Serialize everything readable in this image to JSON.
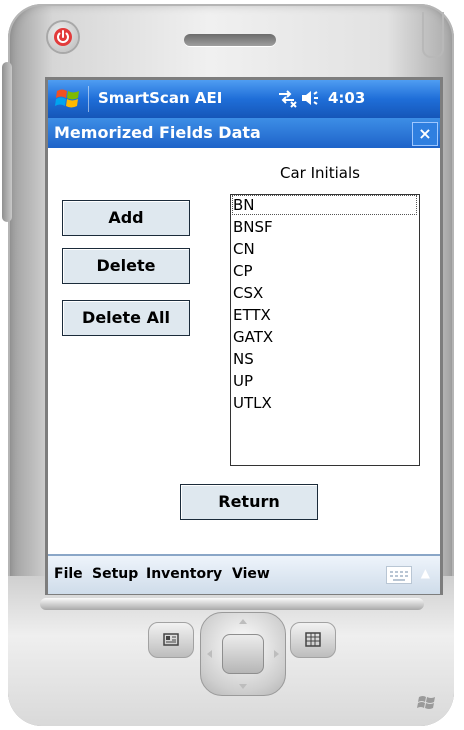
{
  "status_bar": {
    "app_title": "SmartScan AEI",
    "time": "4:03"
  },
  "window": {
    "title": "Memorized Fields Data",
    "close_label": "×"
  },
  "field": {
    "label": "Car Initials"
  },
  "buttons": {
    "add": "Add",
    "delete": "Delete",
    "delete_all": "Delete All",
    "return": "Return"
  },
  "list": {
    "items": [
      "BN",
      "BNSF",
      "CN",
      "CP",
      "CSX",
      "ETTX",
      "GATX",
      "NS",
      "UP",
      "UTLX"
    ],
    "selected_index": 0
  },
  "menu": {
    "file": "File",
    "setup": "Setup",
    "inventory": "Inventory",
    "view": "View"
  },
  "icons": {
    "start": "windows-flag-icon",
    "connectivity": "connectivity-icon",
    "volume": "speaker-icon",
    "keyboard": "keyboard-icon",
    "power": "power-icon"
  },
  "colors": {
    "title_bar": "#1f6ed8",
    "menu_bar": "#dbe6f2",
    "button_face": "#dfe8ef"
  }
}
